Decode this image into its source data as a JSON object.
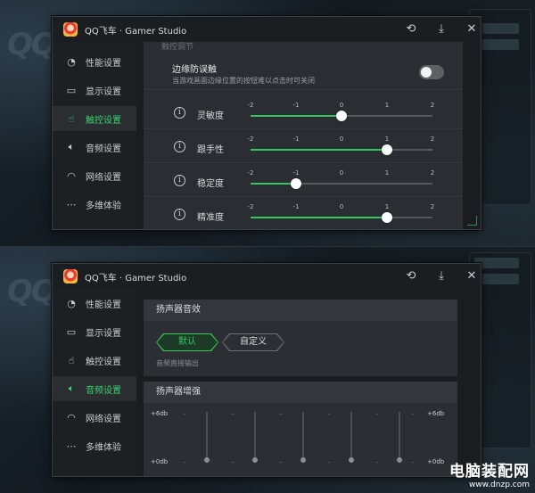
{
  "panels": [
    {
      "title": "QQ飞车 · Gamer Studio",
      "sidebar": [
        {
          "label": "性能设置",
          "icon": "speedometer-icon"
        },
        {
          "label": "显示设置",
          "icon": "monitor-icon"
        },
        {
          "label": "触控设置",
          "icon": "touch-hand-icon",
          "active": true
        },
        {
          "label": "音频设置",
          "icon": "speaker-icon"
        },
        {
          "label": "网络设置",
          "icon": "wifi-icon"
        },
        {
          "label": "多维体验",
          "icon": "more-dots-icon"
        }
      ],
      "content": {
        "cut_header": "触控调节",
        "edge_protection": {
          "title": "边缘防误触",
          "desc": "当游戏画面边缘位置的按钮难以点击时可关闭",
          "enabled": false
        },
        "ticks": [
          "-2",
          "-1",
          "0",
          "1",
          "2"
        ],
        "sliders": [
          {
            "label": "灵敏度",
            "value": 0
          },
          {
            "label": "跟手性",
            "value": 1
          },
          {
            "label": "稳定度",
            "value": -1
          },
          {
            "label": "精准度",
            "value": 1
          }
        ]
      }
    },
    {
      "title": "QQ飞车 · Gamer Studio",
      "sidebar": [
        {
          "label": "性能设置",
          "icon": "speedometer-icon"
        },
        {
          "label": "显示设置",
          "icon": "monitor-icon"
        },
        {
          "label": "触控设置",
          "icon": "touch-hand-icon"
        },
        {
          "label": "音频设置",
          "icon": "speaker-icon",
          "active": true
        },
        {
          "label": "网络设置",
          "icon": "wifi-icon"
        },
        {
          "label": "多维体验",
          "icon": "more-dots-icon"
        }
      ],
      "content": {
        "speaker_effect": {
          "title": "扬声器音效",
          "options": [
            "默认",
            "自定义"
          ],
          "selected": "默认",
          "note": "音频直接输出"
        },
        "speaker_boost": {
          "title": "扬声器增强",
          "top_label": "+6db",
          "bottom_label": "+0db",
          "band_levels": [
            0,
            0,
            0,
            0,
            0
          ]
        }
      }
    }
  ],
  "watermark": {
    "line1": "电脑装配网",
    "line2": "www.dnzp.com"
  },
  "colors": {
    "accent": "#35c65f",
    "window_bg": "#1e2124",
    "panel_bg": "#2a2d31"
  }
}
